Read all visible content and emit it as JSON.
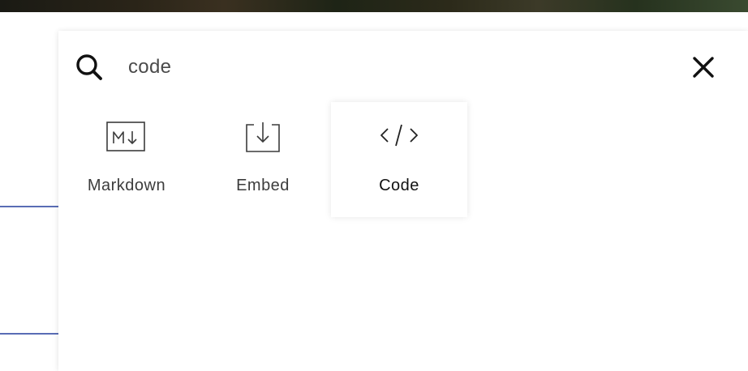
{
  "search": {
    "value": "code",
    "icon": "search-icon"
  },
  "close": {
    "icon": "close-icon"
  },
  "results": [
    {
      "label": "Markdown",
      "icon": "markdown-icon",
      "selected": false
    },
    {
      "label": "Embed",
      "icon": "embed-icon",
      "selected": false
    },
    {
      "label": "Code",
      "icon": "code-icon",
      "selected": true
    }
  ],
  "colors": {
    "accent_line": "#5a6db5",
    "icon_stroke": "#3c3c3c",
    "text": "#3c3c3c",
    "selected_text": "#111111"
  }
}
